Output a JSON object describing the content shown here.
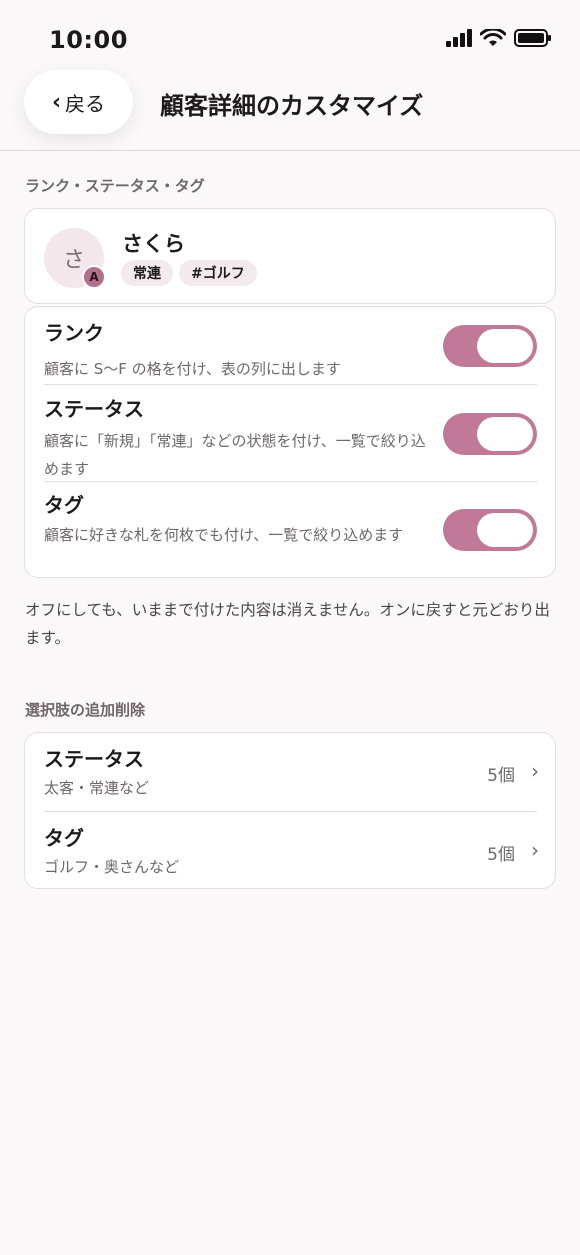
{
  "status_bar": {
    "time": "10:00",
    "icons": [
      "signal-icon",
      "wifi-icon",
      "battery-icon"
    ]
  },
  "header": {
    "back_label": "戻る",
    "title": "顧客詳細のカスタマイズ"
  },
  "section1": {
    "label": "ランク・ステータス・タグ"
  },
  "profile": {
    "avatar_initial": "さ",
    "rank": "A",
    "name": "さくら",
    "chips": [
      "常連",
      "#ゴルフ"
    ]
  },
  "toggles": [
    {
      "title": "ランク",
      "desc": "顧客に S〜F の格を付け、表の列に出します",
      "on": true
    },
    {
      "title": "ステータス",
      "desc": "顧客に「新規」「常連」などの状態を付け、一覧で絞り込めます",
      "on": true
    },
    {
      "title": "タグ",
      "desc": "顧客に好きな札を何枚でも付け、一覧で絞り込めます",
      "on": true
    }
  ],
  "footnote": "オフにしても、いままで付けた内容は消えません。オンに戻すと元どおり出ます。",
  "section2": {
    "label": "選択肢の追加削除"
  },
  "choices": [
    {
      "title": "ステータス",
      "sub": "太客・常連など",
      "count": "5個"
    },
    {
      "title": "タグ",
      "sub": "ゴルフ・奥さんなど",
      "count": "5個"
    }
  ],
  "colors": {
    "accent": "#c07a98",
    "background": "#faf8f9",
    "card": "#ffffff"
  }
}
